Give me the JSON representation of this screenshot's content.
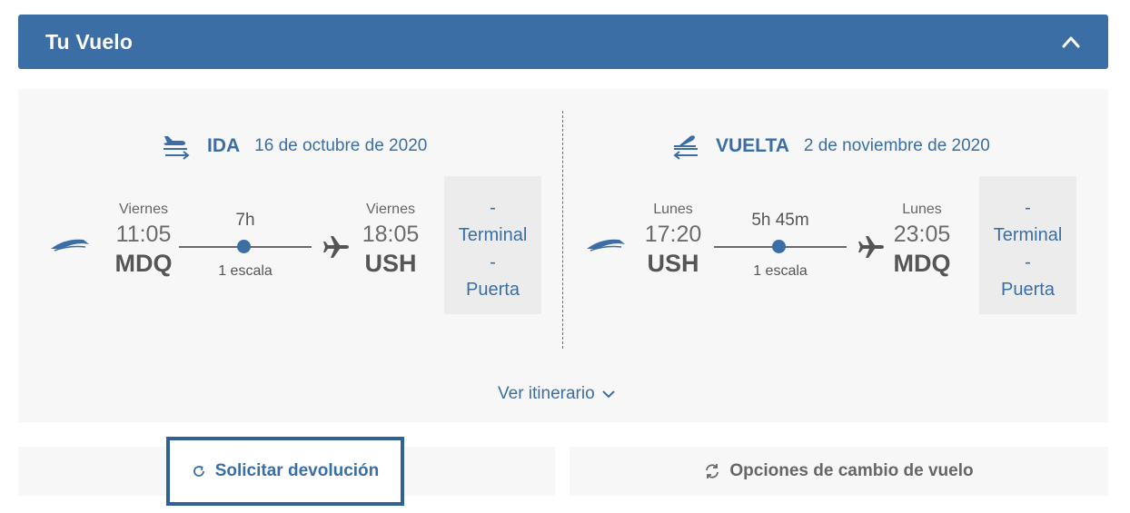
{
  "header": {
    "title": "Tu Vuelo",
    "toggle_icon": "chevron-up-icon"
  },
  "colors": {
    "primary": "#3a6ea5",
    "panel_bg": "#f7f7f7",
    "box_bg": "#ececec",
    "text_gray": "#555555"
  },
  "outbound": {
    "label": "IDA",
    "date": "16 de octubre de 2020",
    "icon": "plane-landing-arrow-right-icon",
    "origin": {
      "day": "Viernes",
      "time": "11:05",
      "code": "MDQ"
    },
    "duration": "7h",
    "stops": "1 escala",
    "destination": {
      "day": "Viernes",
      "time": "18:05",
      "code": "USH"
    },
    "terminal_value": "-",
    "terminal_label": "Terminal",
    "gate_value": "-",
    "gate_label": "Puerta"
  },
  "return": {
    "label": "VUELTA",
    "date": "2 de noviembre de 2020",
    "icon": "plane-takeoff-arrow-left-icon",
    "origin": {
      "day": "Lunes",
      "time": "17:20",
      "code": "USH"
    },
    "duration": "5h 45m",
    "stops": "1 escala",
    "destination": {
      "day": "Lunes",
      "time": "23:05",
      "code": "MDQ"
    },
    "terminal_value": "-",
    "terminal_label": "Terminal",
    "gate_value": "-",
    "gate_label": "Puerta"
  },
  "itinerary_link": "Ver itinerario",
  "actions": {
    "refund": "Solicitar devolución",
    "change": "Opciones de cambio de vuelo"
  }
}
